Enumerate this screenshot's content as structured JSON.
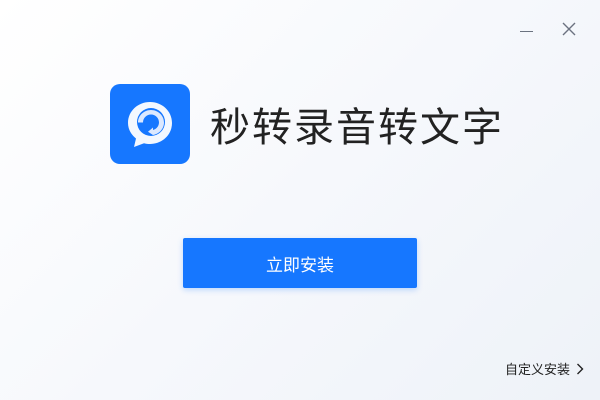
{
  "window": {
    "controls": {
      "minimize_icon": "minimize-icon",
      "close_icon": "close-icon"
    }
  },
  "brand": {
    "app_name": "秒转录音转文字",
    "logo_icon": "app-logo-icon",
    "logo_color": "#1677ff"
  },
  "actions": {
    "install_label": "立即安装",
    "custom_install_label": "自定义安装",
    "custom_install_icon": "chevron-right-icon"
  },
  "colors": {
    "accent": "#1677ff",
    "text": "#222222"
  }
}
